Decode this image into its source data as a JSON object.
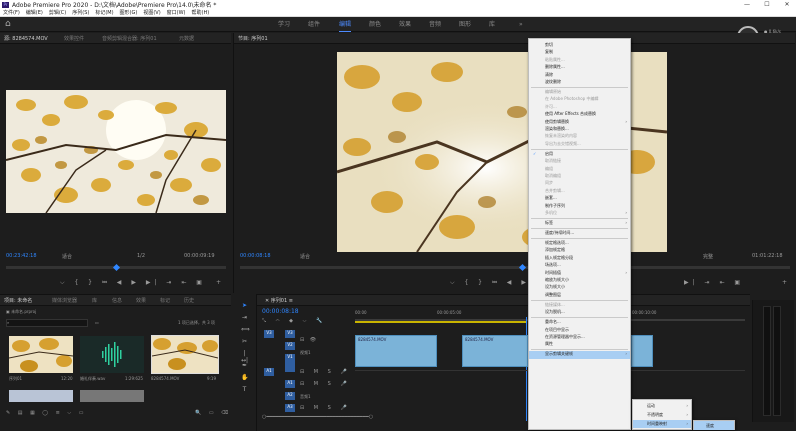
{
  "app": {
    "title": "Adobe Premiere Pro 2020 - D:\\文档\\Adobe\\Premiere Pro\\14.0\\未命名 *",
    "min": "—",
    "max": "☐",
    "close": "✕"
  },
  "menu": [
    "文件(F)",
    "编辑(E)",
    "剪辑(C)",
    "序列(S)",
    "标记(M)",
    "图形(G)",
    "视图(V)",
    "窗口(W)",
    "帮助(H)"
  ],
  "workspace": {
    "tabs": [
      "学习",
      "组件",
      "编辑",
      "颜色",
      "效果",
      "音频",
      "图形",
      "库"
    ],
    "active": "编辑",
    "more": "»"
  },
  "perf": {
    "value": "37",
    "unit": "%",
    "up": "0.6k/s",
    "down": "0k/s"
  },
  "source": {
    "tabs": [
      "源: 8284574.MOV",
      "效果控件",
      "音频剪辑混合器: 序列01",
      "元数据"
    ],
    "timecode": "00:23:42:18",
    "fit": "适合",
    "quality": "1/2",
    "duration": "00:00:09:19"
  },
  "program": {
    "title": "节目: 序列01",
    "timecode": "00:00:08:18",
    "fit": "适合",
    "quality": "完整",
    "duration": "01:01:22:18"
  },
  "project": {
    "tabs": [
      "项目: 未命名",
      "媒体浏览器",
      "库",
      "信息",
      "效果",
      "标记",
      "历史"
    ],
    "file": "未命名.prproj",
    "search_placeholder": "",
    "selection": "1 项已选择，共 3 项",
    "items": [
      {
        "name": "序列01",
        "dur": "12:20"
      },
      {
        "name": "婚礼伴奏.wav",
        "dur": "1:29:625"
      },
      {
        "name": "8284574.MOV",
        "dur": "9:19"
      }
    ]
  },
  "timeline": {
    "tab": "序列01",
    "timecode": "00:00:08:18",
    "ruler": [
      "00:00",
      "00:00:05:00",
      "00:00:10:00"
    ],
    "tracks": [
      "V3",
      "V2",
      "V1",
      "A1",
      "A2",
      "A3"
    ],
    "v1_label": "视频1",
    "a1_label": "音频1",
    "clip1": "8284574.MOV",
    "clip2": "8284574.MOV"
  },
  "context_menu": {
    "items": [
      {
        "label": "剪切",
        "disabled": false
      },
      {
        "label": "复制",
        "disabled": false
      },
      {
        "label": "粘贴属性...",
        "disabled": true
      },
      {
        "label": "删除属性...",
        "disabled": false
      },
      {
        "label": "清除",
        "disabled": false
      },
      {
        "label": "波纹删除",
        "disabled": false
      },
      {
        "sep": true
      },
      {
        "label": "编辑原始",
        "disabled": true
      },
      {
        "label": "在 Adobe Photoshop 中编辑",
        "disabled": true
      },
      {
        "label": "许可...",
        "disabled": true
      },
      {
        "label": "使用 After Effects 合成替换",
        "disabled": false
      },
      {
        "label": "使用剪辑替换",
        "disabled": false,
        "sub": true
      },
      {
        "label": "渲染和替换...",
        "disabled": false
      },
      {
        "label": "恢复未渲染的内容",
        "disabled": true
      },
      {
        "label": "导出为去交错视频...",
        "disabled": true
      },
      {
        "sep": true
      },
      {
        "label": "启用",
        "disabled": false,
        "checked": true
      },
      {
        "label": "取消链接",
        "disabled": true
      },
      {
        "label": "编组",
        "disabled": true
      },
      {
        "label": "取消编组",
        "disabled": true
      },
      {
        "label": "同步",
        "disabled": true
      },
      {
        "label": "合并剪辑...",
        "disabled": true
      },
      {
        "label": "嵌套...",
        "disabled": false
      },
      {
        "label": "制作子序列",
        "disabled": false
      },
      {
        "label": "多机位",
        "disabled": true,
        "sub": true
      },
      {
        "sep": true
      },
      {
        "label": "标签",
        "disabled": false,
        "sub": true
      },
      {
        "sep": true
      },
      {
        "label": "速度/持续时间...",
        "disabled": false
      },
      {
        "sep": true
      },
      {
        "label": "帧定格选项...",
        "disabled": false
      },
      {
        "label": "添加帧定格",
        "disabled": false
      },
      {
        "label": "插入帧定格分段",
        "disabled": false
      },
      {
        "label": "场选项...",
        "disabled": false
      },
      {
        "label": "时间插值",
        "disabled": false,
        "sub": true
      },
      {
        "label": "缩放为帧大小",
        "disabled": false
      },
      {
        "label": "设为帧大小",
        "disabled": false
      },
      {
        "label": "调整图层",
        "disabled": false
      },
      {
        "sep": true
      },
      {
        "label": "链接媒体...",
        "disabled": true
      },
      {
        "label": "设为脱机...",
        "disabled": false
      },
      {
        "sep": true
      },
      {
        "label": "重命名...",
        "disabled": false
      },
      {
        "label": "在项目中显示",
        "disabled": false
      },
      {
        "label": "在资源管理器中显示...",
        "disabled": false
      },
      {
        "label": "属性",
        "disabled": false
      },
      {
        "sep": true
      },
      {
        "label": "显示剪辑关键帧",
        "disabled": false,
        "sub": true,
        "highlight": true
      }
    ]
  },
  "submenu1": [
    "运动",
    "不透明度",
    "时间重映射"
  ],
  "submenu2": [
    "速度"
  ],
  "colors": {
    "accent": "#2f86ff",
    "clip": "#7bb3d8",
    "menu_bg": "#f1f1f1",
    "highlight": "#a8cef3"
  }
}
